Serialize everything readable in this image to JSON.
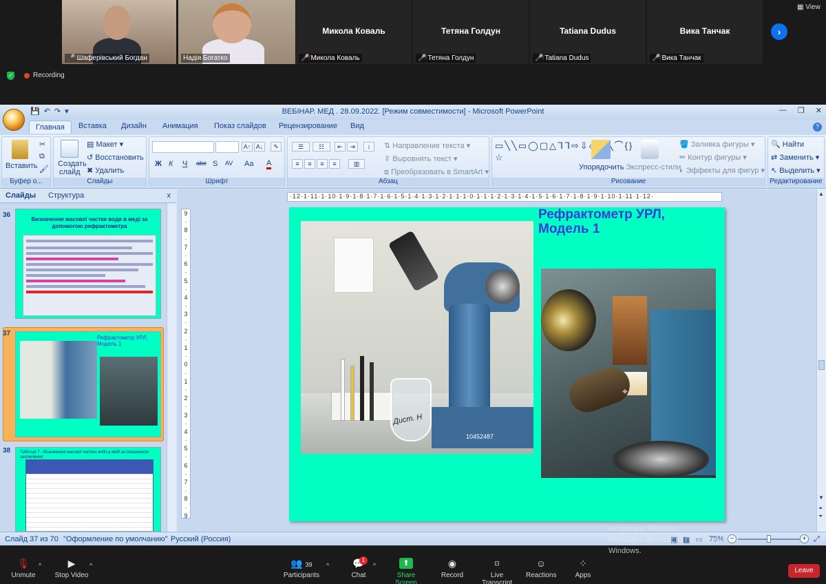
{
  "gallery": {
    "participants": [
      {
        "name": "Шаферівський Богдан",
        "muted": true,
        "video": true
      },
      {
        "name": "Надія Богатко",
        "muted": false,
        "video": true
      },
      {
        "name": "Микола Коваль",
        "muted": true,
        "video": false
      },
      {
        "name": "Тетяна Голдун",
        "muted": true,
        "video": false
      },
      {
        "name": "Tatiana Dudus",
        "muted": true,
        "video": false
      },
      {
        "name": "Вика Танчак",
        "muted": true,
        "video": false
      }
    ],
    "view_label": "View",
    "recording_label": "Recording"
  },
  "ppt": {
    "window_title": "ВЕБІНАР. МЕД . 28.09.2022. [Режим совместимости] - Microsoft PowerPoint",
    "tabs": [
      "Главная",
      "Вставка",
      "Дизайн",
      "Анимация",
      "Показ слайдов",
      "Рецензирование",
      "Вид"
    ],
    "ribbon": {
      "clipboard": {
        "label": "Буфер о...",
        "paste": "Вставить"
      },
      "slides": {
        "label": "Слайды",
        "new_slide_1": "Создать",
        "new_slide_2": "слайд",
        "layout": "Макет",
        "reset": "Восстановить",
        "delete": "Удалить"
      },
      "font": {
        "label": "Шрифт",
        "bold": "Ж",
        "italic": "К",
        "underline": "Ч",
        "strike": "abe",
        "shadow": "S",
        "spacing": "AV",
        "case": "Aa",
        "color": "A"
      },
      "paragraph": {
        "label": "Абзац",
        "text_direction": "Направление текста",
        "align_text": "Выровнять текст",
        "smartart": "Преобразовать в SmartArt"
      },
      "drawing": {
        "label": "Рисование",
        "arrange": "Упорядочить",
        "quick_styles": "Экспресс-стили",
        "fill": "Заливка фигуры",
        "outline": "Контур фигуры",
        "effects": "Эффекты для фигур"
      },
      "editing": {
        "label": "Редактирование",
        "find": "Найти",
        "replace": "Заменить",
        "select": "Выделить"
      }
    },
    "panel": {
      "tab_slides": "Слайды",
      "tab_outline": "Структура",
      "close": "x",
      "slides": [
        {
          "number": "36",
          "title": "Визначення масової частки води в меді за допомогою рефрактометра"
        },
        {
          "number": "37",
          "title": "Рефрактометр УРЛ, Модель 1",
          "selected": true
        },
        {
          "number": "38",
          "title": "Таблиця 7 - Визначення масової частки води в меді за показником заломлення"
        }
      ]
    },
    "slide": {
      "title": "Рефрактометр УРЛ, Модель 1",
      "photo_label": "Дист. H",
      "serial": "10452487"
    },
    "ruler_h": "·12·1·11·1·10·1·9·1·8·1·7·1·6·1·5·1·4·1·3·1·2·1·1·1·0·1·1·1·2·1·3·1·4·1·5·1·6·1·7·1·8·1·9·1·10·1·11·1·12·",
    "ruler_v": [
      "9",
      "·",
      "8",
      "·",
      "7",
      "·",
      "6",
      "·",
      "5",
      "·",
      "4",
      "·",
      "3",
      "·",
      "2",
      "·",
      "1",
      "·",
      "0",
      "·",
      "1",
      "·",
      "2",
      "·",
      "3",
      "·",
      "4",
      "·",
      "5",
      "·",
      "6",
      "·",
      "7",
      "·",
      "8",
      "·",
      "9"
    ],
    "status": {
      "slide_of": "Слайд 37 из 70",
      "theme": "\"Оформление по умолчанию\"",
      "language": "Русский (Россия)",
      "zoom": "75%",
      "zoom_fraction": 0.5
    },
    "watermark_line1": "Активация Windows",
    "watermark_line2": "Перейдіть до розділу Параметри,",
    "watermark_line3": "Windows."
  },
  "toolbar": {
    "unmute": "Unmute",
    "stop_video": "Stop Video",
    "participants": "Participants",
    "participants_count": "39",
    "chat": "Chat",
    "chat_badge": "1",
    "share_screen": "Share Screen",
    "record": "Record",
    "live_transcript": "Live Transcript",
    "reactions": "Reactions",
    "apps": "Apps",
    "leave": "Leave"
  }
}
